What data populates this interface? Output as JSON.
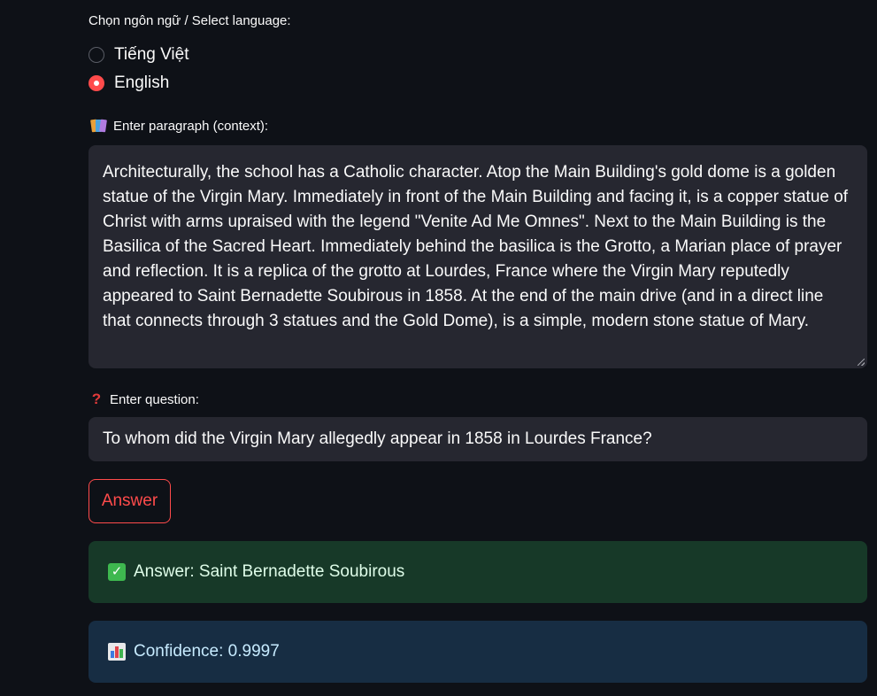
{
  "language": {
    "label": "Chọn ngôn ngữ / Select language:",
    "options": [
      {
        "label": "Tiếng Việt",
        "selected": false
      },
      {
        "label": "English",
        "selected": true
      }
    ]
  },
  "context": {
    "icon": "books-icon",
    "label": "Enter paragraph (context):",
    "value": "Architecturally, the school has a Catholic character. Atop the Main Building's gold dome is a golden statue of the Virgin Mary. Immediately in front of the Main Building and facing it, is a copper statue of Christ with arms upraised with the legend \"Venite Ad Me Omnes\". Next to the Main Building is the Basilica of the Sacred Heart. Immediately behind the basilica is the Grotto, a Marian place of prayer and reflection. It is a replica of the grotto at Lourdes, France where the Virgin Mary reputedly appeared to Saint Bernadette Soubirous in 1858. At the end of the main drive (and in a direct line that connects through 3 statues and the Gold Dome), is a simple, modern stone statue of Mary."
  },
  "question": {
    "icon": "question-mark-icon",
    "label": "Enter question:",
    "value": "To whom did the Virgin Mary allegedly appear in 1858 in Lourdes France?"
  },
  "answer_button": {
    "label": "Answer"
  },
  "result": {
    "answer_icon": "check-mark-icon",
    "answer_text": "Answer: Saint Bernadette Soubirous",
    "confidence_icon": "bar-chart-icon",
    "confidence_text": "Confidence: 0.9997"
  },
  "colors": {
    "background": "#0e1117",
    "input_background": "#262730",
    "accent": "#ff4b4b",
    "success_background": "#173928",
    "info_background": "#172d43"
  }
}
